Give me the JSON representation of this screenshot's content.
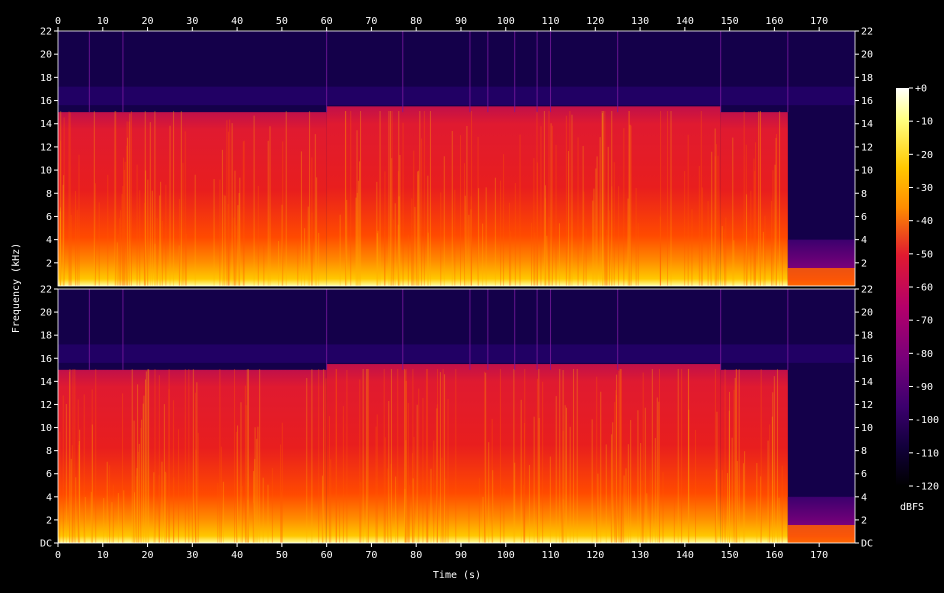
{
  "chart_data": {
    "type": "heatmap",
    "title": "",
    "xlabel": "Time (s)",
    "ylabel": "Frequency (kHz)",
    "colorbar_label": "dBFS",
    "xlim": [
      0,
      178
    ],
    "ylim": [
      0,
      22
    ],
    "x_ticks": [
      "0",
      "10",
      "20",
      "30",
      "40",
      "50",
      "60",
      "70",
      "80",
      "90",
      "100",
      "110",
      "120",
      "130",
      "140",
      "150",
      "160",
      "170"
    ],
    "y_ticks_top": [
      "2",
      "4",
      "6",
      "8",
      "10",
      "12",
      "14",
      "16",
      "18",
      "20",
      "22"
    ],
    "y_ticks_bottom": [
      "DC",
      "2",
      "4",
      "6",
      "8",
      "10",
      "12",
      "14",
      "16",
      "18",
      "20",
      "22"
    ],
    "colorbar_ticks": [
      "+0",
      "-10",
      "-20",
      "-30",
      "-40",
      "-50",
      "-60",
      "-70",
      "-80",
      "-90",
      "-100",
      "-110",
      "-120"
    ],
    "colorbar_range": [
      -120,
      0
    ],
    "colors": [
      "#000000",
      "#12003c",
      "#3c006e",
      "#78007a",
      "#b4006a",
      "#e01a30",
      "#ff4a00",
      "#ff8c00",
      "#ffc800",
      "#ffff80",
      "#ffffff"
    ],
    "channels": [
      {
        "name": "",
        "segments": [
          {
            "t_start": 0,
            "t_end": 60,
            "cutoff_khz": 15.0,
            "level_dbfs": -45
          },
          {
            "t_start": 60,
            "t_end": 148,
            "cutoff_khz": 15.5,
            "level_dbfs": -42
          },
          {
            "t_start": 148,
            "t_end": 163,
            "cutoff_khz": 15.0,
            "level_dbfs": -48
          },
          {
            "t_start": 163,
            "t_end": 178,
            "cutoff_khz": 4.0,
            "level_dbfs": -85
          }
        ]
      },
      {
        "name": "",
        "segments": [
          {
            "t_start": 0,
            "t_end": 60,
            "cutoff_khz": 15.0,
            "level_dbfs": -45
          },
          {
            "t_start": 60,
            "t_end": 148,
            "cutoff_khz": 15.5,
            "level_dbfs": -42
          },
          {
            "t_start": 148,
            "t_end": 163,
            "cutoff_khz": 15.0,
            "level_dbfs": -48
          },
          {
            "t_start": 163,
            "t_end": 178,
            "cutoff_khz": 4.0,
            "level_dbfs": -85
          }
        ]
      }
    ]
  }
}
